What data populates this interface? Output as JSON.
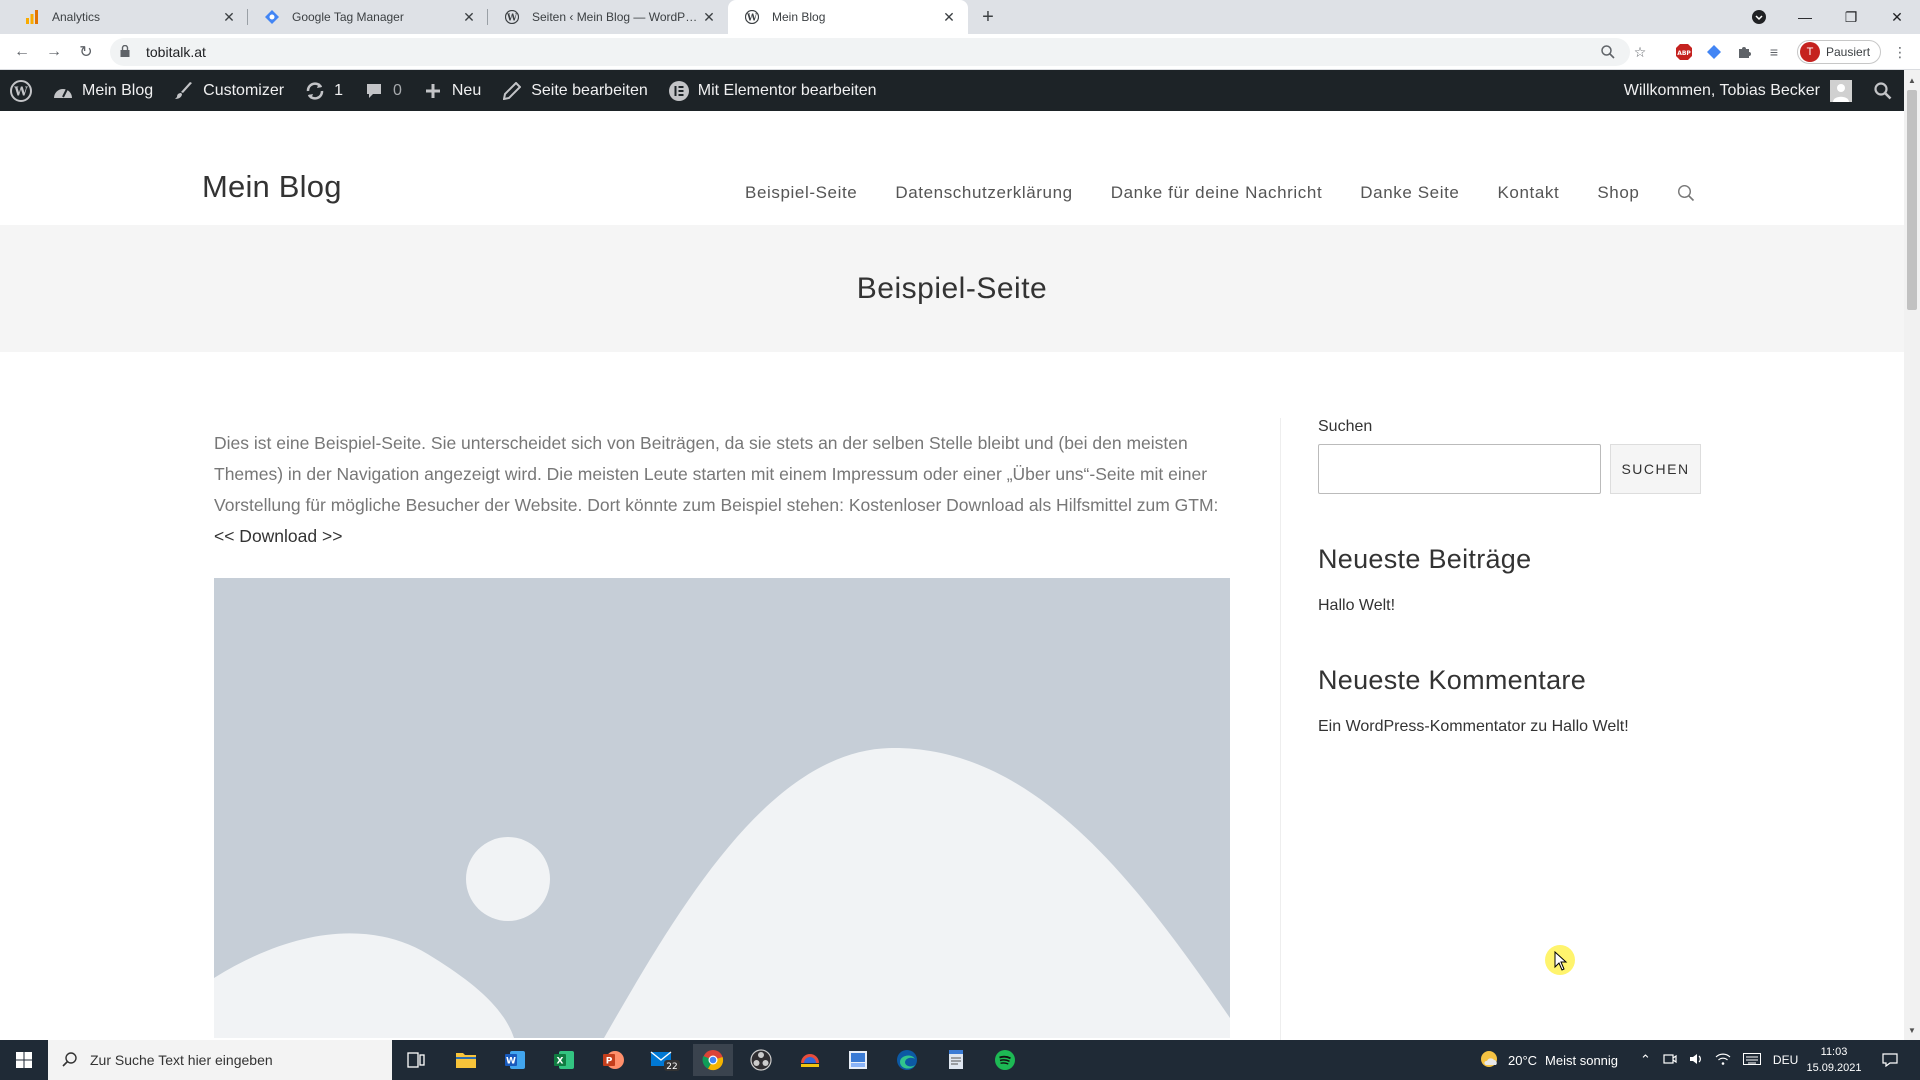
{
  "browser": {
    "tabs": [
      {
        "title": "Analytics",
        "icon": "analytics-icon"
      },
      {
        "title": "Google Tag Manager",
        "icon": "gtm-icon"
      },
      {
        "title": "Seiten ‹ Mein Blog — WordPress",
        "icon": "wordpress-icon"
      },
      {
        "title": "Mein Blog",
        "icon": "wordpress-icon"
      }
    ],
    "url": "tobitalk.at",
    "profile_initial": "T",
    "profile_status": "Pausiert"
  },
  "adminbar": {
    "site": "Mein Blog",
    "customizer": "Customizer",
    "updates_count": "1",
    "comments_count": "0",
    "new": "Neu",
    "edit_page": "Seite bearbeiten",
    "elementor": "Mit Elementor bearbeiten",
    "welcome": "Willkommen, Tobias Becker"
  },
  "site": {
    "title": "Mein Blog",
    "nav": [
      "Beispiel-Seite",
      "Datenschutzerklärung",
      "Danke für deine Nachricht",
      "Danke Seite",
      "Kontakt",
      "Shop"
    ]
  },
  "page": {
    "title": "Beispiel-Seite",
    "body": "Dies ist eine Beispiel-Seite. Sie unterscheidet sich von Beiträgen, da sie stets an der selben Stelle bleibt und (bei den meisten Themes) in der Navigation angezeigt wird. Die meisten Leute starten mit einem Impressum oder einer „Über uns“-Seite mit einer Vorstellung für mögliche Besucher der Website. Dort könnte zum Beispiel stehen: Kostenloser Download als Hilfsmittel zum GTM:",
    "download_link": "<< Download >>"
  },
  "sidebar": {
    "search_label": "Suchen",
    "search_button": "SUCHEN",
    "recent_posts_title": "Neueste Beiträge",
    "recent_posts": [
      "Hallo Welt!"
    ],
    "recent_comments_title": "Neueste Kommentare",
    "comment_author": "Ein WordPress-Kommentator",
    "comment_on": "zu",
    "comment_post": "Hallo Welt!"
  },
  "taskbar": {
    "search_placeholder": "Zur Suche Text hier eingeben",
    "mail_badge": "22",
    "weather_temp": "20°C",
    "weather_text": "Meist sonnig",
    "language": "DEU",
    "time": "11:03",
    "date": "15.09.2021"
  },
  "colors": {
    "adminbar_bg": "#1d2327",
    "taskbar_bg": "#1f2a36",
    "placeholder_bg": "#c6ced7"
  }
}
